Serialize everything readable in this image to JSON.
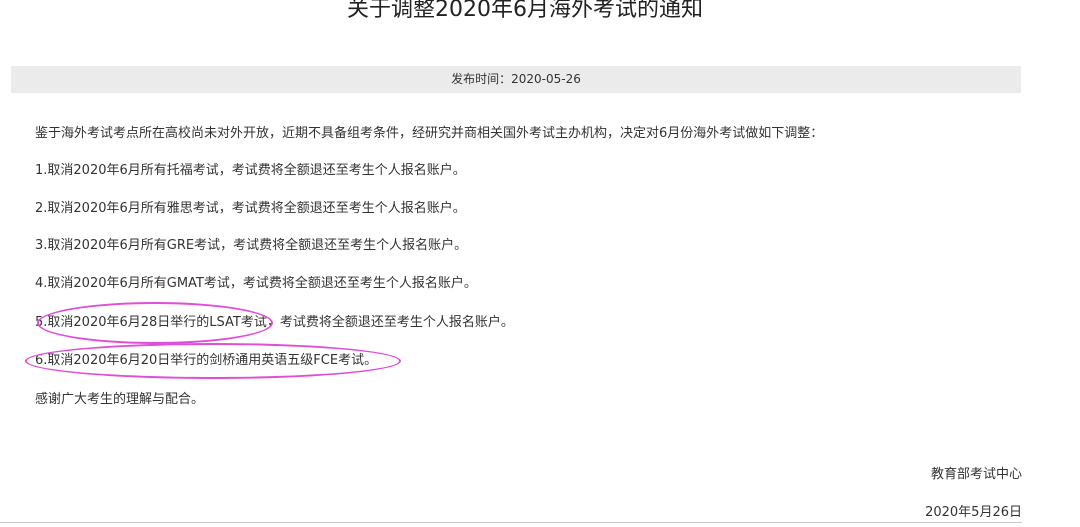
{
  "title": "关于调整2020年6月海外考试的通知",
  "publish": {
    "label": "发布时间：2020-05-26"
  },
  "intro": "鉴于海外考试考点所在高校尚未对外开放，近期不具备组考条件，经研究并商相关国外考试主办机构，决定对6月份海外考试做如下调整：",
  "items": [
    "1.取消2020年6月所有托福考试，考试费将全额退还至考生个人报名账户。",
    "2.取消2020年6月所有雅思考试，考试费将全额退还至考生个人报名账户。",
    "3.取消2020年6月所有GRE考试，考试费将全额退还至考生个人报名账户。",
    "4.取消2020年6月所有GMAT考试，考试费将全额退还至考生个人报名账户。"
  ],
  "item5": {
    "highlighted": "5.取消2020年6月28日举行的LSAT考试，",
    "rest": "考试费将全额退还至考生个人报名账户。"
  },
  "item6": {
    "highlighted": "6.取消2020年6月20日举行的剑桥通用英语五级FCE考试。"
  },
  "closing": "感谢广大考生的理解与配合。",
  "signature": {
    "org": "教育部考试中心",
    "date": "2020年5月26日"
  },
  "colors": {
    "annotation": "#e04ed8",
    "meta_bar": "#ebebeb"
  }
}
